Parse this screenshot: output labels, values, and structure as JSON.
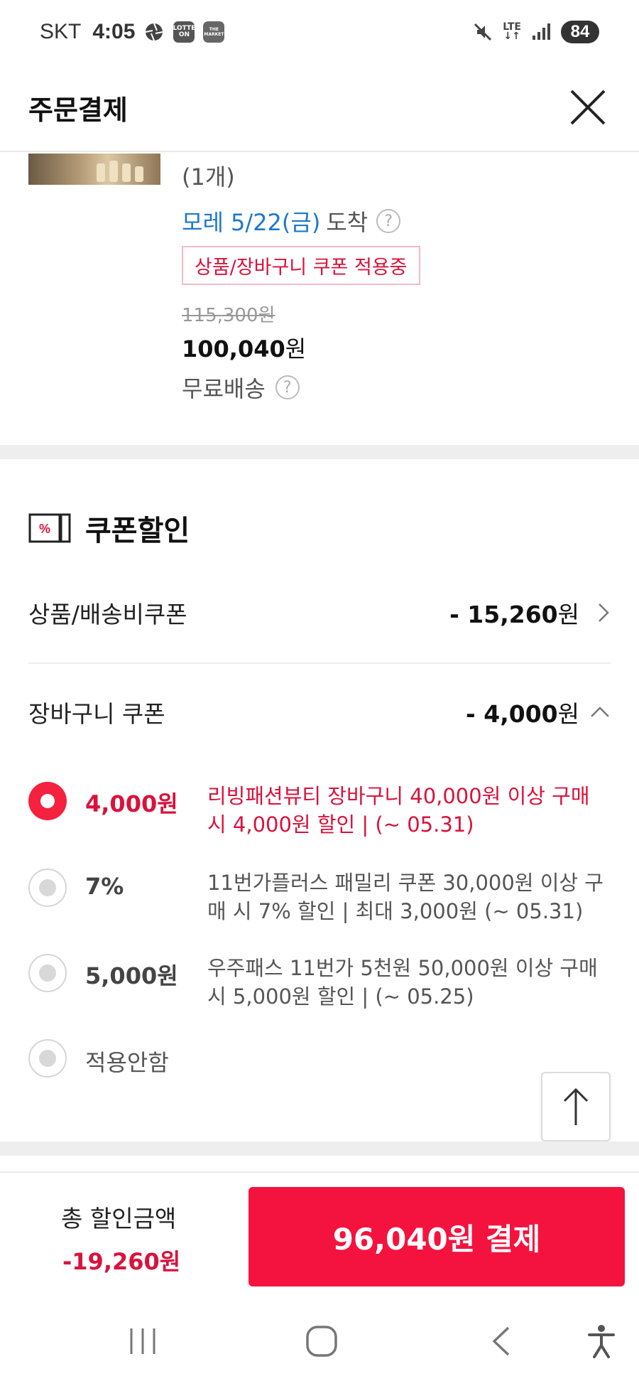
{
  "status_bar": {
    "carrier": "SKT",
    "time": "4:05",
    "app_icons": [
      "aperture-icon",
      "lotte-on-icon",
      "the-market-icon"
    ],
    "lotte_on_label": "LOTTE ON",
    "the_market_label": "THE MARKET",
    "network": "LTE",
    "battery": "84"
  },
  "header": {
    "title": "주문결제",
    "close_icon": "close-icon"
  },
  "product": {
    "quantity": "(1개)",
    "arrival_date": "모레 5/22(금)",
    "arrival_text": "도착",
    "coupon_tag": "상품/장바구니 쿠폰 적용중",
    "original_price": "115,300원",
    "sale_price_number": "100,040",
    "sale_price_unit": "원",
    "shipping": "무료배송",
    "help_icon_glyph": "?"
  },
  "coupon_section": {
    "icon": "coupon-percent-icon",
    "title": "쿠폰할인",
    "product_shipping_coupon": {
      "label": "상품/배송비쿠폰",
      "amount": "- 15,260",
      "unit": "원"
    },
    "cart_coupon": {
      "label": "장바구니 쿠폰",
      "amount": "- 4,000",
      "unit": "원"
    },
    "options": [
      {
        "amount": "4,000",
        "unit": "원",
        "desc": "리빙패션뷰티 장바구니 40,000원 이상 구매 시 4,000원 할인 | (~ 05.31)",
        "selected": true
      },
      {
        "amount": "7%",
        "unit": "",
        "desc": "11번가플러스 패밀리 쿠폰 30,000원 이상 구매 시 7% 할인 | 최대 3,000원 (~ 05.31)",
        "selected": false
      },
      {
        "amount": "5,000",
        "unit": "원",
        "desc": "우주패스 11번가 5천원 50,000원 이상 구매 시 5,000원 할인 | (~ 05.25)",
        "selected": false
      }
    ],
    "no_apply_label": "적용안함"
  },
  "bottom_bar": {
    "total_label": "총 할인금액",
    "total_value": "-19,260원",
    "pay_button": "96,040원 결제"
  },
  "nav_bar": {
    "icons": [
      "recent-apps-icon",
      "home-icon",
      "back-icon",
      "accessibility-icon"
    ]
  },
  "colors": {
    "accent_red": "#f4133e",
    "text_red": "#d9123c",
    "link_blue": "#1e78c8",
    "divider": "#eeeeee"
  }
}
